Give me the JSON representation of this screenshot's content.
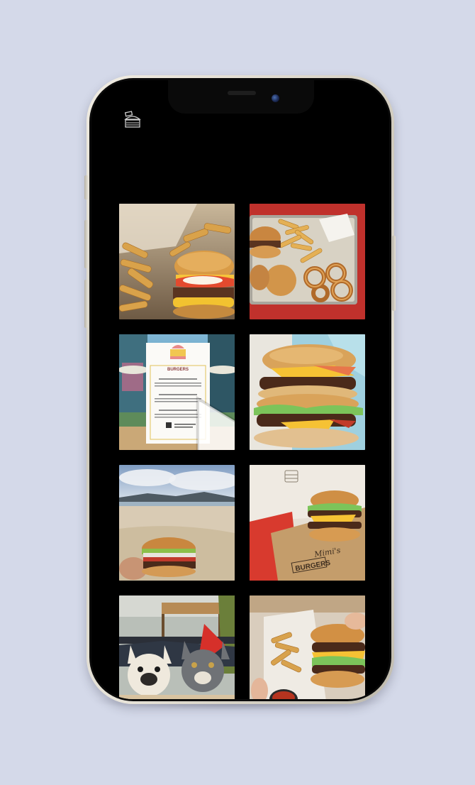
{
  "app": {
    "background_color": "#d4d9e9",
    "screen_color": "#000000",
    "logo_icon": "burger-shop-logo-icon"
  },
  "feed": {
    "posts": [
      {
        "id": 1,
        "subject": "burger-with-fries-photo",
        "is_video": false
      },
      {
        "id": 2,
        "subject": "burger-fries-onion-rings-tray-photo",
        "is_video": false
      },
      {
        "id": 3,
        "subject": "menu-board-photo",
        "is_video": true,
        "menu": {
          "heading": "BURGERS",
          "items": [
            "Mimi's Classic Burger",
            "Smash Melt Burger",
            "Bacon - Mimi's Burger"
          ]
        }
      },
      {
        "id": 4,
        "subject": "double-stack-burger-photo",
        "is_video": false
      },
      {
        "id": 5,
        "subject": "burger-at-beach-photo",
        "is_video": false
      },
      {
        "id": 6,
        "subject": "burger-on-branded-paper-photo",
        "brand_text": "Mimi's BURGERS",
        "is_video": false
      },
      {
        "id": 7,
        "subject": "two-french-bulldogs-photo",
        "is_video": false
      },
      {
        "id": 8,
        "subject": "burger-held-in-hand-photo",
        "is_video": false
      }
    ]
  }
}
